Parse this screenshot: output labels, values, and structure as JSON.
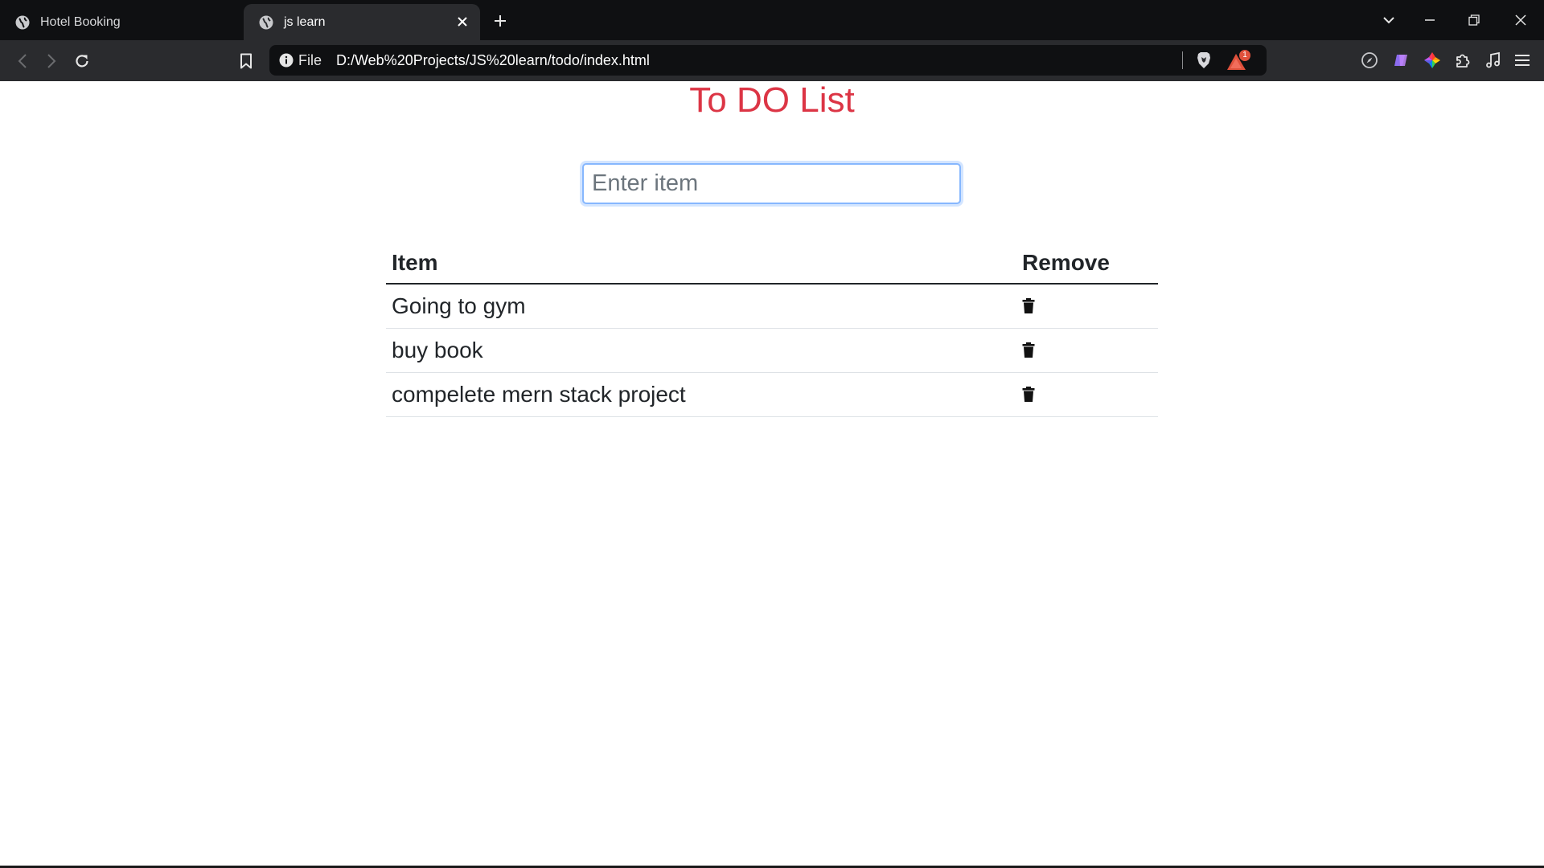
{
  "browser": {
    "tabs": [
      {
        "title": "Hotel Booking",
        "active": false
      },
      {
        "title": "js learn",
        "active": true
      }
    ],
    "address": {
      "scheme_label": "File",
      "url": "D:/Web%20Projects/JS%20learn/todo/index.html"
    },
    "rewards_badge": "1"
  },
  "page": {
    "title": "To DO List",
    "title_color": "#dc3545",
    "input": {
      "placeholder": "Enter item",
      "value": ""
    },
    "table": {
      "headers": {
        "item": "Item",
        "remove": "Remove"
      },
      "rows": [
        {
          "item": "Going to gym",
          "remove_icon": "trash-icon"
        },
        {
          "item": "buy book",
          "remove_icon": "trash-icon"
        },
        {
          "item": "compelete mern stack project",
          "remove_icon": "trash-icon"
        }
      ]
    }
  }
}
